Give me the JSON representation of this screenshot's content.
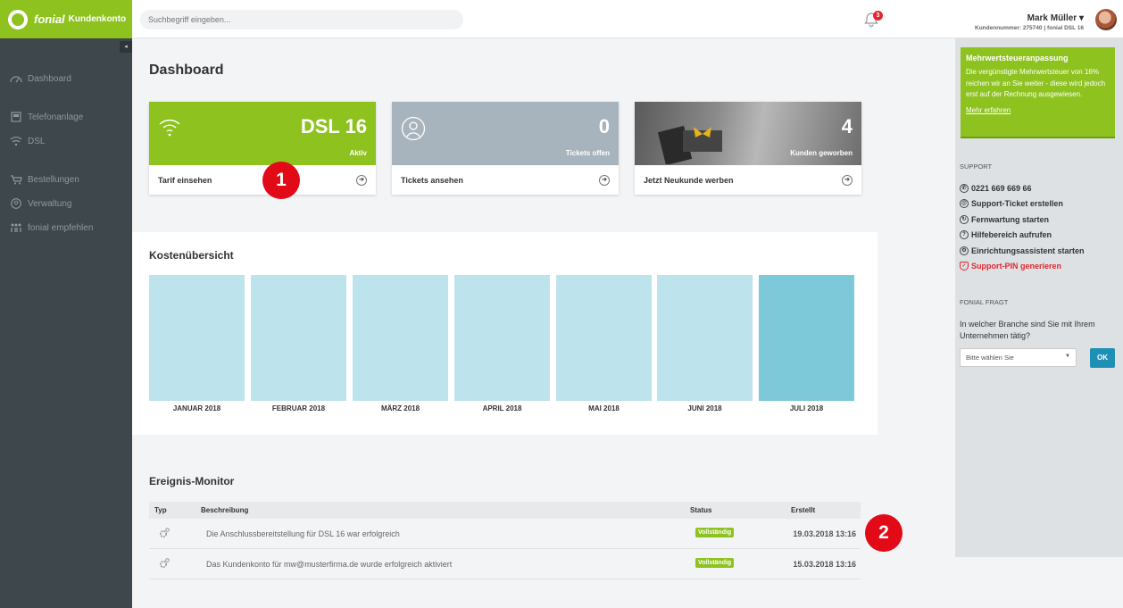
{
  "brand": {
    "name": "fonial",
    "sub": "Kundenkonto"
  },
  "search": {
    "placeholder": "Suchbegriff eingeben..."
  },
  "notifications": {
    "count": "3"
  },
  "user": {
    "name": "Mark Müller",
    "meta": "Kundennummer: 275740 | fonial DSL 16"
  },
  "sidebar": {
    "collapse": "◂",
    "items": [
      {
        "label": "Dashboard",
        "icon": "speedometer-icon"
      },
      {
        "label": "Telefonanlage",
        "icon": "phone-system-icon"
      },
      {
        "label": "DSL",
        "icon": "wifi-icon"
      },
      {
        "label": "Bestellungen",
        "icon": "cart-icon"
      },
      {
        "label": "Verwaltung",
        "icon": "user-circle-icon"
      },
      {
        "label": "fonial empfehlen",
        "icon": "people-icon"
      }
    ]
  },
  "page": {
    "title": "Dashboard"
  },
  "cards": [
    {
      "big": "DSL 16",
      "small": "Aktiv",
      "link": "Tarif einsehen",
      "color": "#8dc21f"
    },
    {
      "big": "0",
      "small": "Tickets offen",
      "link": "Tickets ansehen",
      "color": "#a8b4bd"
    },
    {
      "big": "4",
      "small": "Kunden geworben",
      "link": "Jetzt Neukunde werben",
      "color": "#7a7a7a"
    }
  ],
  "markers": [
    "1",
    "2"
  ],
  "costs": {
    "title": "Kostenübersicht",
    "months": [
      "JANUAR 2018",
      "FEBRUAR 2018",
      "MÄRZ 2018",
      "APRIL 2018",
      "MAI 2018",
      "JUNI 2018",
      "JULI 2018"
    ]
  },
  "events": {
    "title": "Ereignis-Monitor",
    "columns": {
      "type": "Typ",
      "description": "Beschreibung",
      "status": "Status",
      "created": "Erstellt"
    },
    "rows": [
      {
        "description": "Die Anschlussbereitstellung für DSL 16 war erfolgreich",
        "status": "Vollständig",
        "date": "19.03.2018 13:16"
      },
      {
        "description": "Das Kundenkonto für mw@musterfirma.de wurde erfolgreich aktiviert",
        "status": "Vollständig",
        "date": "15.03.2018 13:16"
      }
    ]
  },
  "notice": {
    "title": "Mehrwertsteueranpassung",
    "text": "Die vergünstigte Mehrwertsteuer von 16% reichen wir an Sie weiter - diese wird jedoch erst auf der Rechnung ausgewiesen.",
    "link": "Mehr erfahren"
  },
  "support": {
    "heading": "SUPPORT",
    "items": [
      {
        "label": "0221 669 669 66",
        "icon": "phone-icon"
      },
      {
        "label": "Support-Ticket erstellen",
        "icon": "ticket-icon"
      },
      {
        "label": "Fernwartung starten",
        "icon": "remote-icon"
      },
      {
        "label": "Hilfebereich aufrufen",
        "icon": "help-icon"
      },
      {
        "label": "Einrichtungsassistent starten",
        "icon": "wrench-icon"
      },
      {
        "label": "Support-PIN generieren",
        "icon": "shield-icon"
      }
    ]
  },
  "survey": {
    "heading": "FONIAL FRAGT",
    "question": "In welcher Branche sind Sie mit Ihrem Unternehmen tätig?",
    "select_value": "Bitte wählen Sie",
    "ok_label": "OK"
  }
}
